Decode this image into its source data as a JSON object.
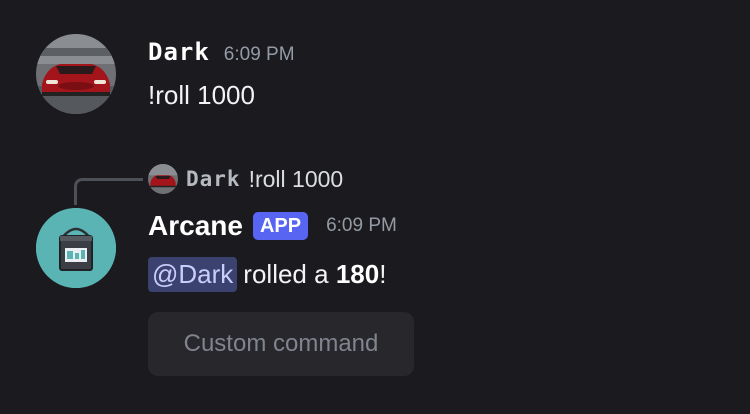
{
  "messages": {
    "first": {
      "author": "Dark",
      "timestamp": "6:09 PM",
      "content": "!roll 1000",
      "avatar_icon": "red-car-avatar"
    },
    "reply": {
      "author": "Dark",
      "content": "!roll 1000",
      "avatar_icon": "red-car-avatar"
    },
    "second": {
      "author": "Arcane",
      "badge": "APP",
      "timestamp": "6:09 PM",
      "mention": "@Dark",
      "text_before": "rolled a",
      "roll_value": "180",
      "text_after": "!",
      "avatar_icon": "paint-bucket-avatar",
      "button_label": "Custom command"
    }
  },
  "colors": {
    "background": "#1b1a1f",
    "app_badge": "#5865f2",
    "mention_bg": "#3c4270",
    "avatar_bg_bot": "#5ab4b4"
  }
}
